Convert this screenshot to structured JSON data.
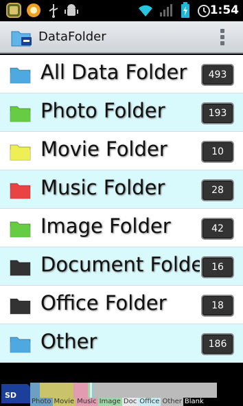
{
  "status_bar": {
    "clock": "1:54",
    "icons": [
      "app-icon",
      "firefox-icon",
      "usb-icon",
      "android-debug-icon",
      "wifi-icon",
      "signal-icon",
      "battery-charging-icon",
      "alarm-icon"
    ]
  },
  "header": {
    "title": "DataFolder",
    "app_icon": "folder-sd-icon",
    "menu_icon": "overflow-menu-icon"
  },
  "folders": [
    {
      "label": "All Data Folder",
      "count": "493",
      "color": "#4ea9e0",
      "bg": "white"
    },
    {
      "label": "Photo Folder",
      "count": "193",
      "color": "#66cc44",
      "bg": "cyan"
    },
    {
      "label": "Movie Folder",
      "count": "10",
      "color": "#eeee55",
      "bg": "white"
    },
    {
      "label": "Music Folder",
      "count": "28",
      "color": "#e84444",
      "bg": "cyan"
    },
    {
      "label": "Image Folder",
      "count": "42",
      "color": "#66cc44",
      "bg": "white"
    },
    {
      "label": "Document Folder",
      "count": "16",
      "color": "#333333",
      "bg": "cyan"
    },
    {
      "label": "Office Folder",
      "count": "18",
      "color": "#333333",
      "bg": "white"
    },
    {
      "label": "Other",
      "count": "186",
      "color": "#4ea9e0",
      "bg": "cyan"
    }
  ],
  "storage": {
    "sd_icon": "sd-card-icon",
    "segments": [
      {
        "name": "Photo",
        "color": "#6b9fc4",
        "fraction": 0.05
      },
      {
        "name": "Movie",
        "color": "#c9c46a",
        "fraction": 0.18
      },
      {
        "name": "Music",
        "color": "#e39bb1",
        "fraction": 0.08
      },
      {
        "name": "Image",
        "color": "#9fd8a8",
        "fraction": 0.01
      },
      {
        "name": "Doc",
        "color": "#e8e8e8",
        "fraction": 0.01
      },
      {
        "name": "Office",
        "color": "#7fd3d8",
        "fraction": 0.01
      },
      {
        "name": "Other",
        "color": "#bbbbbb",
        "fraction": 0.66
      }
    ],
    "legend": [
      {
        "label": "Photo",
        "bg": "#6b9fc4"
      },
      {
        "label": "Movie",
        "bg": "#c9c46a"
      },
      {
        "label": "Music",
        "bg": "#e39bb1"
      },
      {
        "label": "Image",
        "bg": "#9fd8a8"
      },
      {
        "label": "Doc",
        "bg": "#e8e8e8"
      },
      {
        "label": "Office",
        "bg": "#c6eef2"
      },
      {
        "label": "Other",
        "bg": "#bbbbbb"
      },
      {
        "label": "Blank",
        "bg": "#000000"
      }
    ]
  }
}
